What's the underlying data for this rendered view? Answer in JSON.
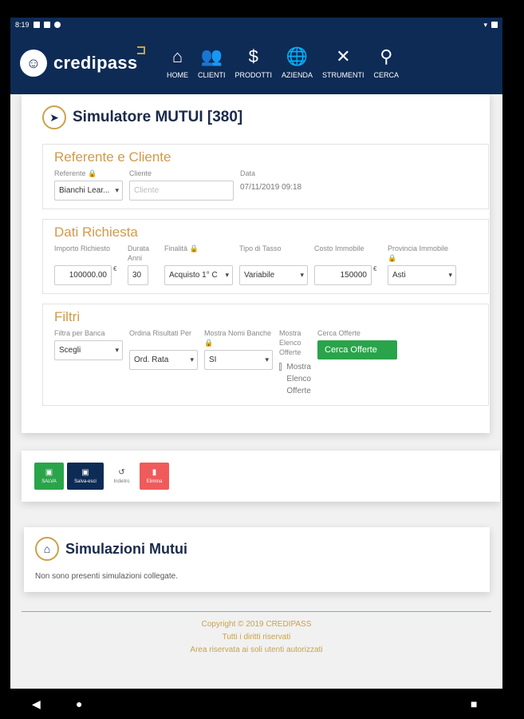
{
  "status": {
    "time": "8:19"
  },
  "brand": {
    "name": "credipass"
  },
  "nav": [
    {
      "label": "Home",
      "icon": "home-icon",
      "glyph": "⌂",
      "dropdown": false
    },
    {
      "label": "Clienti",
      "icon": "users-icon",
      "glyph": "👥",
      "dropdown": true
    },
    {
      "label": "Prodotti",
      "icon": "money-hand-icon",
      "glyph": "$",
      "dropdown": true
    },
    {
      "label": "Azienda",
      "icon": "globe-icon",
      "glyph": "🌐",
      "dropdown": true
    },
    {
      "label": "Strumenti",
      "icon": "tools-icon",
      "glyph": "✕",
      "dropdown": true
    },
    {
      "label": "Cerca",
      "icon": "search-icon",
      "glyph": "⚲",
      "dropdown": false
    }
  ],
  "page": {
    "title": "Simulatore MUTUI [380]"
  },
  "referente": {
    "title": "Referente e Cliente",
    "referente_label": "Referente 🔒",
    "referente_value": "Bianchi Lear...",
    "cliente_label": "Cliente",
    "cliente_placeholder": "Cliente",
    "data_label": "Data",
    "data_value": "07/11/2019 09:18"
  },
  "richiesta": {
    "title": "Dati Richiesta",
    "importo_label": "Importo Richiesto",
    "importo_value": "100000.00",
    "euro": "€",
    "durata_label": "Durata Anni",
    "durata_value": "30",
    "finalita_label": "Finalità 🔒",
    "finalita_value": "Acquisto 1° C",
    "tasso_label": "Tipo di Tasso",
    "tasso_value": "Variabile",
    "costo_label": "Costo Immobile",
    "costo_value": "150000",
    "provincia_label": "Provincia Immobile 🔒",
    "provincia_value": "Asti"
  },
  "filtri": {
    "title": "Filtri",
    "banca_label": "Filtra per Banca",
    "banca_value": "Scegli",
    "ordina_label": "Ordina Risultati Per",
    "ordina_value": "Ord. Rata",
    "nomi_label": "Mostra Nomi Banche 🔒",
    "nomi_value": "SI",
    "elenco_label": "Mostra Elenco Offerte",
    "elenco_check_label": "Mostra Elenco Offerte",
    "cerca_label": "Cerca Offerte",
    "cerca_button": "Cerca Offerte"
  },
  "toolbar": {
    "salva": "SALVA",
    "salva_esci": "Salva-esci",
    "indietro": "Indietro",
    "elimina": "Elimina",
    "colors": {
      "salva": "#2aa44a",
      "salva_esci": "#0d2b55",
      "elimina": "#f05a5a"
    }
  },
  "simulazioni": {
    "title": "Simulazioni Mutui",
    "empty": "Non sono presenti simulazioni collegate."
  },
  "footer": {
    "line1": "Copyright © 2019 CREDIPASS",
    "line2": "Tutti i diritti riservati",
    "line3": "Area riservata ai soli utenti autorizzati"
  }
}
